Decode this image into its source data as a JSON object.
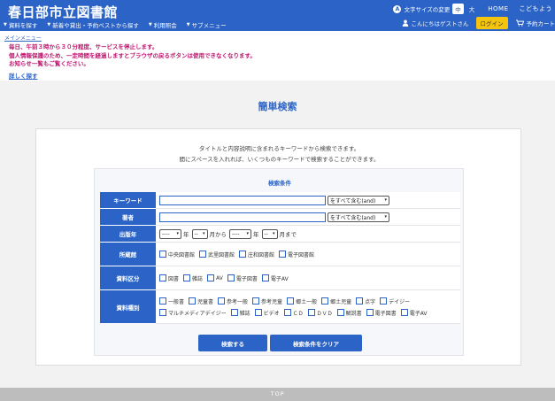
{
  "header": {
    "site_title": "春日部市立図書館",
    "nav": [
      "資料を探す",
      "新着や貸出・予約ベストから探す",
      "利用照会",
      "サブメニュー"
    ],
    "font_size_label": "文字サイズの変更",
    "font_sizes": [
      "中",
      "大"
    ],
    "home": "HOME",
    "kids": "こどもよう",
    "greeting": "こんにちはゲストさん",
    "login": "ログイン",
    "cart": "予約カート"
  },
  "notice": {
    "main_menu": "メインメニュー",
    "lines": [
      "毎日、午前３時から３０分程度、サービスを停止します。",
      "個人情報保護のため、一定時間を経過しますとブラウザの戻るボタンは使用できなくなります。",
      "お知らせ一覧もご覧ください。"
    ],
    "detail_link": "詳しく探す"
  },
  "page_title": "簡単検索",
  "description": [
    "タイトルと内容説明に含まれるキーワードから検索できます。",
    "間にスペースを入れれば、いくつものキーワードで検索することができます。"
  ],
  "conditions": {
    "title": "検索条件",
    "keyword": {
      "label": "キーワード",
      "value": "",
      "mode": "をすべて含む(and)"
    },
    "author": {
      "label": "著者",
      "value": "",
      "mode": "をすべて含む(and)"
    },
    "year": {
      "label": "出版年",
      "from_year": "----",
      "from_month": "--",
      "to_year": "----",
      "to_month": "--",
      "year_text": "年",
      "month_from_text": "月から",
      "month_to_text": "月まで"
    },
    "library": {
      "label": "所蔵館",
      "options": [
        "中央図書館",
        "武里図書館",
        "庄和図書館",
        "電子図書館"
      ]
    },
    "material_class": {
      "label": "資料区分",
      "options": [
        "図書",
        "雑誌",
        "AV",
        "電子図書",
        "電子AV"
      ]
    },
    "material_type": {
      "label": "資料種別",
      "options_row1": [
        "一般書",
        "児童書",
        "参考一般",
        "参考児童",
        "郷土一般",
        "郷土児童",
        "点字",
        "デイジー"
      ],
      "options_row2": [
        "マルチメディアデイジー",
        "雑誌",
        "ビデオ",
        "ＣＤ",
        "ＤＶＤ",
        "解説書",
        "電子図書",
        "電子AV"
      ]
    }
  },
  "buttons": {
    "search": "検索する",
    "clear": "検索条件をクリア"
  },
  "footer": {
    "top": "TOP"
  },
  "colors": {
    "primary": "#2b64c6",
    "notice": "#c0146e",
    "login": "#f4c40f"
  }
}
